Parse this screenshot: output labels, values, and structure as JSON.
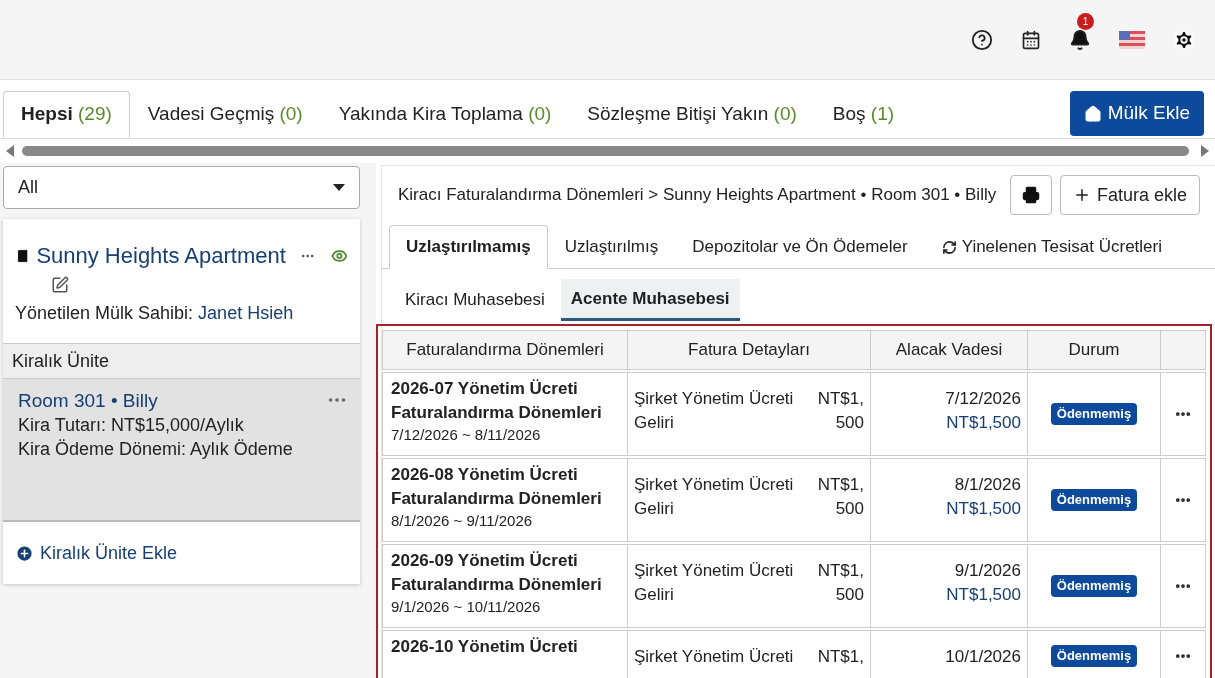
{
  "header": {
    "notification_count": "1"
  },
  "filter_tabs": [
    {
      "label": "Hepsi",
      "count": "(29)",
      "selected": true
    },
    {
      "label": "Vadesi Geçmiş",
      "count": "(0)",
      "selected": false
    },
    {
      "label": "Yakında Kira Toplama",
      "count": "(0)",
      "selected": false
    },
    {
      "label": "Sözleşme Bitişi Yakın",
      "count": "(0)",
      "selected": false
    },
    {
      "label": "Boş",
      "count": "(1)",
      "selected": false
    }
  ],
  "add_property_button": "Mülk Ekle",
  "sidebar": {
    "filter": {
      "value": "All"
    },
    "property": {
      "name": "Sunny Heights Apartment",
      "owner_label": "Yönetilen Mülk Sahibi:",
      "owner": "Janet Hsieh"
    },
    "units_header": "Kiralık Ünite",
    "units": [
      {
        "title": "Room 301 • Billy",
        "rent": "Kira Tutarı: NT$15,000/Aylık",
        "period": "Kira Ödeme Dönemi: Aylık Ödeme",
        "selected": true
      }
    ],
    "add_unit": "Kiralık Ünite Ekle"
  },
  "main": {
    "breadcrumb": "Kiracı Faturalandırma Dönemleri > Sunny Heights Apartment • Room 301 • Billy",
    "add_invoice_button": "Fatura ekle",
    "tabs": [
      {
        "label": "Uzlaştırılmamış",
        "selected": true,
        "kind": "plain"
      },
      {
        "label": "Uzlaştırılmış",
        "selected": false,
        "kind": "plain"
      },
      {
        "label": "Depozitolar ve Ön Ödemeler",
        "selected": false,
        "kind": "plain"
      },
      {
        "label": "Yinelenen Tesisat Ücretleri",
        "selected": false,
        "kind": "recurring"
      }
    ],
    "sub_tabs": [
      {
        "label": "Kiracı Muhasebesi",
        "selected": false
      },
      {
        "label": "Acente Muhasebesi",
        "selected": true
      }
    ],
    "table": {
      "columns": [
        "Faturalandırma Dönemleri",
        "Fatura Detayları",
        "Alacak Vadesi",
        "Durum"
      ],
      "rows": [
        {
          "title": "2026-07 Yönetim Ücreti Faturalandırma Dönemleri",
          "range": "7/12/2026 ~ 8/11/2026",
          "item": "Şirket Yönetim Ücreti Geliri",
          "amount": [
            "NT$1,",
            "500"
          ],
          "due_date": "7/12/2026",
          "due_amount": "NT$1,500",
          "status": "Ödenmemiş",
          "kind": "unpaid"
        },
        {
          "title": "2026-08 Yönetim Ücreti Faturalandırma Dönemleri",
          "range": "8/1/2026 ~ 9/11/2026",
          "item": "Şirket Yönetim Ücreti Geliri",
          "amount": [
            "NT$1,",
            "500"
          ],
          "due_date": "8/1/2026",
          "due_amount": "NT$1,500",
          "status": "Ödenmemiş",
          "kind": "unpaid"
        },
        {
          "title": "2026-09 Yönetim Ücreti Faturalandırma Dönemleri",
          "range": "9/1/2026 ~ 10/11/2026",
          "item": "Şirket Yönetim Ücreti Geliri",
          "amount": [
            "NT$1,",
            "500"
          ],
          "due_date": "9/1/2026",
          "due_amount": "NT$1,500",
          "status": "Ödenmemiş",
          "kind": "unpaid"
        },
        {
          "title": "2026-10 Yönetim Ücreti",
          "item": "Şirket Yönetim Ücreti",
          "amount": [
            "NT$1,"
          ],
          "due_date": "10/1/2026",
          "status": "Ödenmemiş",
          "kind": "unpaid"
        }
      ]
    }
  }
}
